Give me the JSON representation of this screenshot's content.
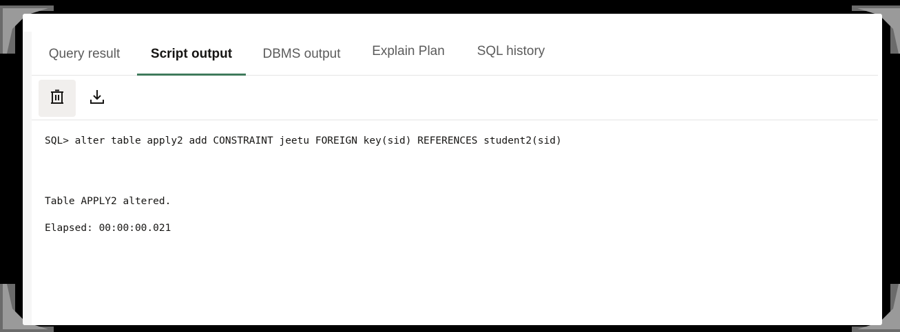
{
  "tabs": [
    {
      "label": "Query result",
      "active": false
    },
    {
      "label": "Script output",
      "active": true
    },
    {
      "label": "DBMS output",
      "active": false
    },
    {
      "label": "Explain Plan",
      "active": false
    },
    {
      "label": "SQL history",
      "active": false
    }
  ],
  "toolbar": {
    "clear_icon": "trash-icon",
    "download_icon": "download-icon"
  },
  "output": {
    "command": "SQL> alter table apply2 add CONSTRAINT jeetu FOREIGN key(sid) REFERENCES student2(sid)",
    "result": "Table APPLY2 altered.",
    "elapsed": "Elapsed: 00:00:00.021"
  },
  "colors": {
    "active_tab_underline": "#3f7a5b",
    "active_tab_text": "#161513",
    "inactive_tab_text": "#5b5b5b",
    "frame": "#000000"
  }
}
